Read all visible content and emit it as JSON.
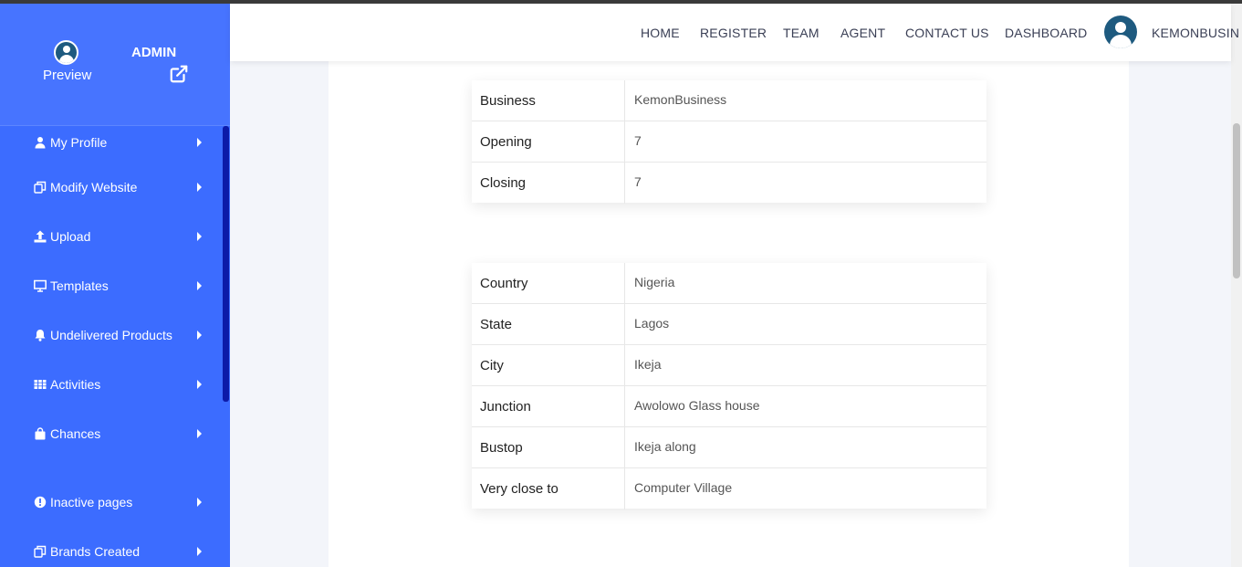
{
  "sidebar": {
    "preview_label": "Preview",
    "admin_label": "ADMIN",
    "items": [
      {
        "label": "My Profile",
        "icon": "user-icon"
      },
      {
        "label": "Modify Website",
        "icon": "copy-icon"
      },
      {
        "label": "Upload",
        "icon": "upload-icon"
      },
      {
        "label": "Templates",
        "icon": "monitor-icon"
      },
      {
        "label": "Undelivered Products",
        "icon": "bell-icon"
      },
      {
        "label": "Activities",
        "icon": "grid-icon"
      },
      {
        "label": "Chances",
        "icon": "bag-icon"
      },
      {
        "label": "Inactive pages",
        "icon": "alert-circle-icon"
      },
      {
        "label": "Brands Created",
        "icon": "copy-icon"
      }
    ]
  },
  "navbar": {
    "links": [
      "HOME",
      "REGISTER",
      "TEAM",
      "AGENT",
      "CONTACT US",
      "DASHBOARD"
    ],
    "user_label": "KEMONBUSIN"
  },
  "business_table": [
    {
      "key": "Business",
      "value": "KemonBusiness"
    },
    {
      "key": "Opening",
      "value": "7"
    },
    {
      "key": "Closing",
      "value": "7"
    }
  ],
  "location_table": [
    {
      "key": "Country",
      "value": "Nigeria"
    },
    {
      "key": "State",
      "value": "Lagos"
    },
    {
      "key": "City",
      "value": "Ikeja"
    },
    {
      "key": "Junction",
      "value": "Awolowo Glass house"
    },
    {
      "key": "Bustop",
      "value": "Ikeja along"
    },
    {
      "key": "Very close to",
      "value": "Computer Village"
    }
  ],
  "colors": {
    "sidebar": "#3c6cff",
    "sidebar_header": "#4774ff",
    "scroll_thumb": "#0c1aa8",
    "avatar": "#1e5a7f"
  }
}
